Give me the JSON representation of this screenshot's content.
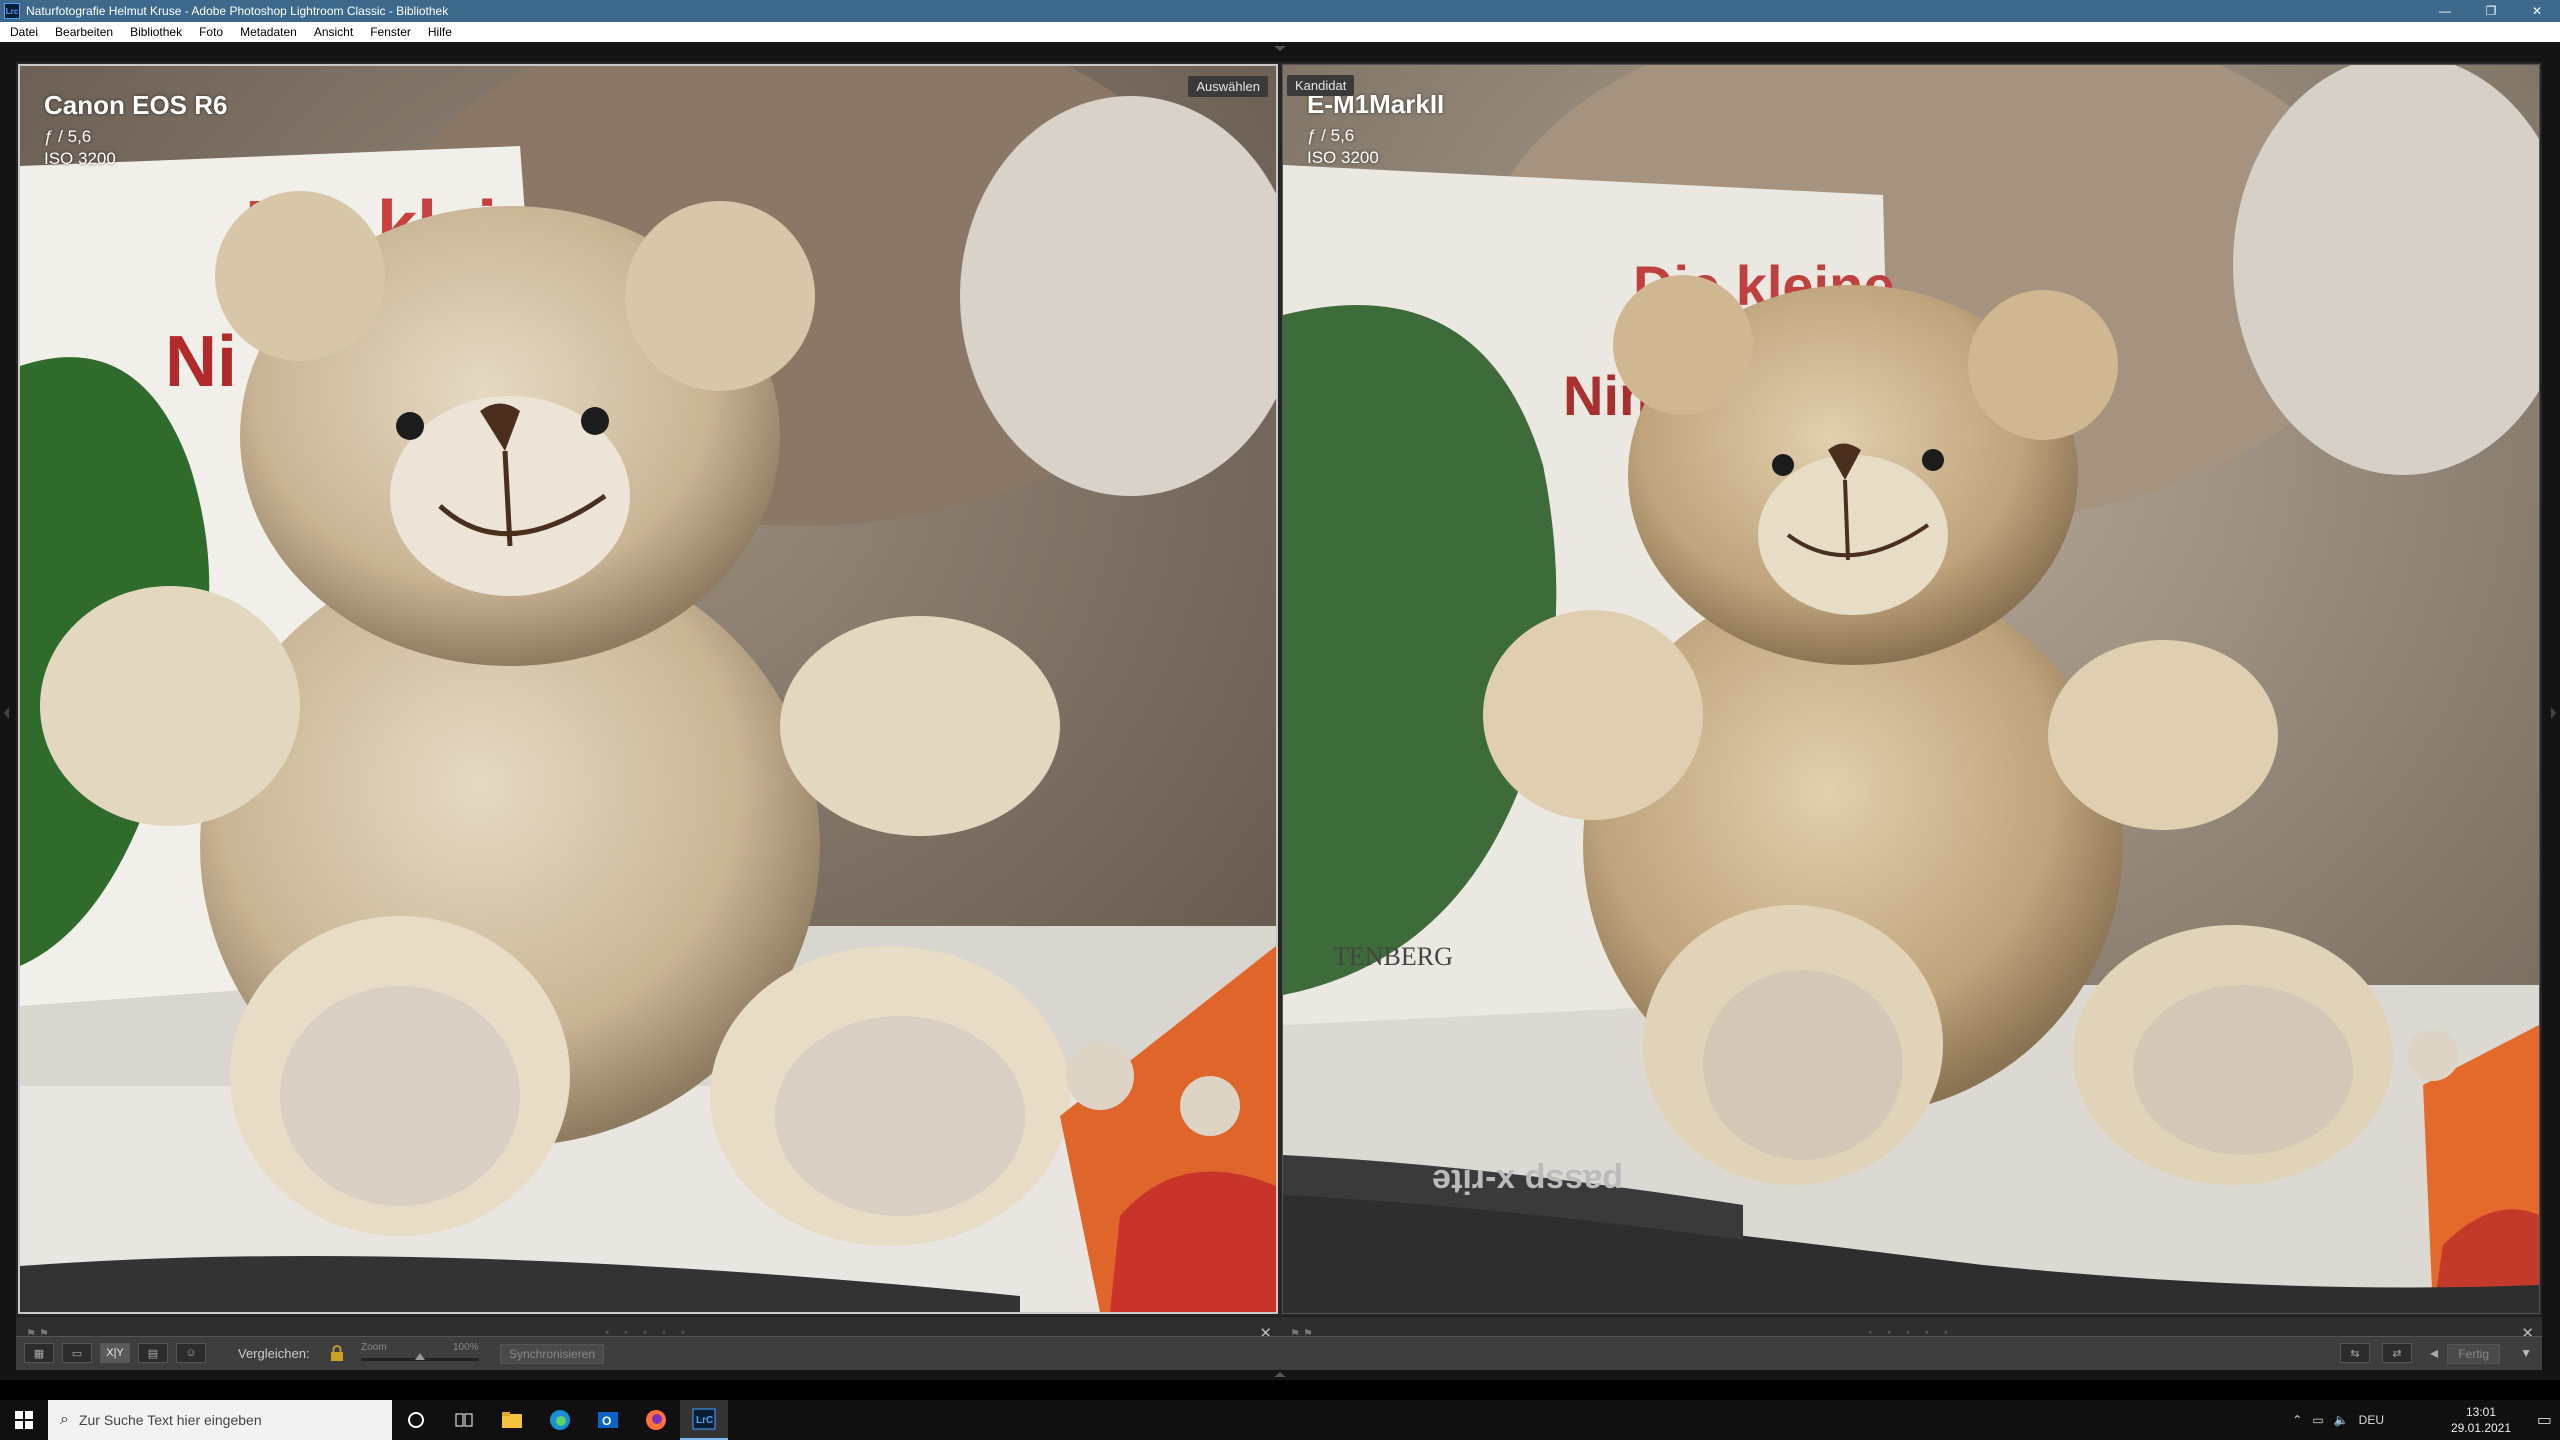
{
  "window": {
    "title": "Naturfotografie Helmut Kruse - Adobe Photoshop Lightroom Classic - Bibliothek",
    "app_icon_text": "Lrc",
    "controls": {
      "minimize": "—",
      "maximize": "❐",
      "close": "✕"
    }
  },
  "menu": [
    "Datei",
    "Bearbeiten",
    "Bibliothek",
    "Foto",
    "Metadaten",
    "Ansicht",
    "Fenster",
    "Hilfe"
  ],
  "compare": {
    "select": {
      "badge": "Auswählen",
      "camera": "Canon EOS R6",
      "aperture": "ƒ / 5,6",
      "iso": "ISO 3200",
      "book_text": [
        "Die klei",
        "Ni"
      ]
    },
    "candidate": {
      "badge": "Kandidat",
      "camera": "E-M1MarkII",
      "aperture": "ƒ / 5,6",
      "iso": "ISO 3200",
      "book_text": [
        "Die kleine",
        "Nim",
        "TENBERG"
      ],
      "strap_text": "passp  x-rite"
    },
    "pane_dots": "• • • • •",
    "close_glyph": "✕"
  },
  "toolbar": {
    "compare_label": "Vergleichen:",
    "zoom_label": "Zoom",
    "zoom_pct": "100%",
    "zoom_value": 0.5,
    "sync_label": "Synchronisieren",
    "done_label": "Fertig",
    "xy_label": "X|Y"
  },
  "taskbar": {
    "search_placeholder": "Zur Suche Text hier eingeben",
    "lang": "DEU",
    "time": "13:01",
    "date": "29.01.2021",
    "lrc_label": "LrC"
  },
  "colors": {
    "titlebar": "#3d6a8c",
    "accent": "#7cb7f0"
  }
}
